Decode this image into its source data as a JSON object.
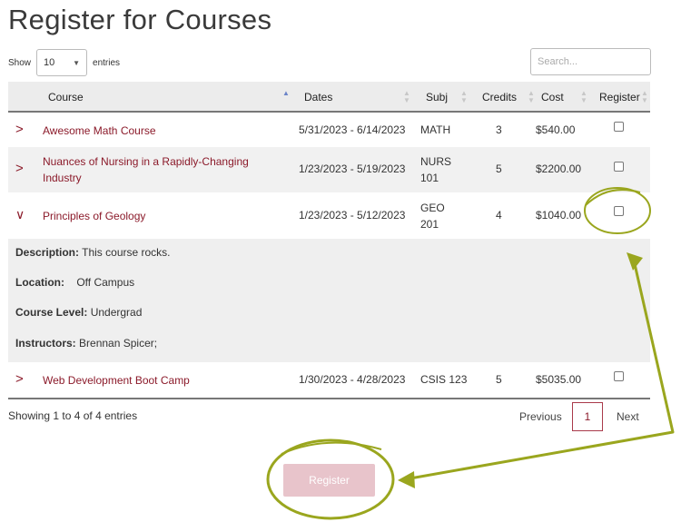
{
  "page": {
    "title": "Register for Courses"
  },
  "length_menu": {
    "show_label": "Show",
    "value": "10",
    "entries_label": "entries"
  },
  "search": {
    "placeholder": "Search..."
  },
  "columns": {
    "course": "Course",
    "dates": "Dates",
    "subj": "Subj",
    "credits": "Credits",
    "cost": "Cost",
    "register": "Register"
  },
  "rows": [
    {
      "course": "Awesome Math Course",
      "dates": "5/31/2023 - 6/14/2023",
      "subj": "MATH",
      "credits": "3",
      "cost": "$540.00",
      "expanded": false,
      "checked": false
    },
    {
      "course_line1": "Nuances of Nursing in a Rapidly-Changing",
      "course_line2": "Industry",
      "dates": "1/23/2023 - 5/19/2023",
      "subj_line1": "NURS",
      "subj_line2": "101",
      "credits": "5",
      "cost": "$2200.00",
      "expanded": false,
      "checked": false
    },
    {
      "course": "Principles of Geology",
      "dates": "1/23/2023 - 5/12/2023",
      "subj_line1": "GEO",
      "subj_line2": "201",
      "credits": "4",
      "cost": "$1040.00",
      "expanded": true,
      "checked": false
    },
    {
      "course": "Web Development Boot Camp",
      "dates": "1/30/2023 - 4/28/2023",
      "subj": "CSIS 123",
      "credits": "5",
      "cost": "$5035.00",
      "expanded": false,
      "checked": false
    }
  ],
  "detail": {
    "description_label": "Description:",
    "description_value": "This course rocks.",
    "location_label": "Location:",
    "location_value": "Off Campus",
    "level_label": "Course Level:",
    "level_value": "Undergrad",
    "instructors_label": "Instructors:",
    "instructors_value": "Brennan Spicer;"
  },
  "footer": {
    "info": "Showing 1 to 4 of 4 entries",
    "previous": "Previous",
    "page": "1",
    "next": "Next"
  },
  "register_button": {
    "label": "Register"
  },
  "colors": {
    "link": "#8b1a2a",
    "annotation": "#9aa61e",
    "register_button": "#e8c4cb"
  }
}
